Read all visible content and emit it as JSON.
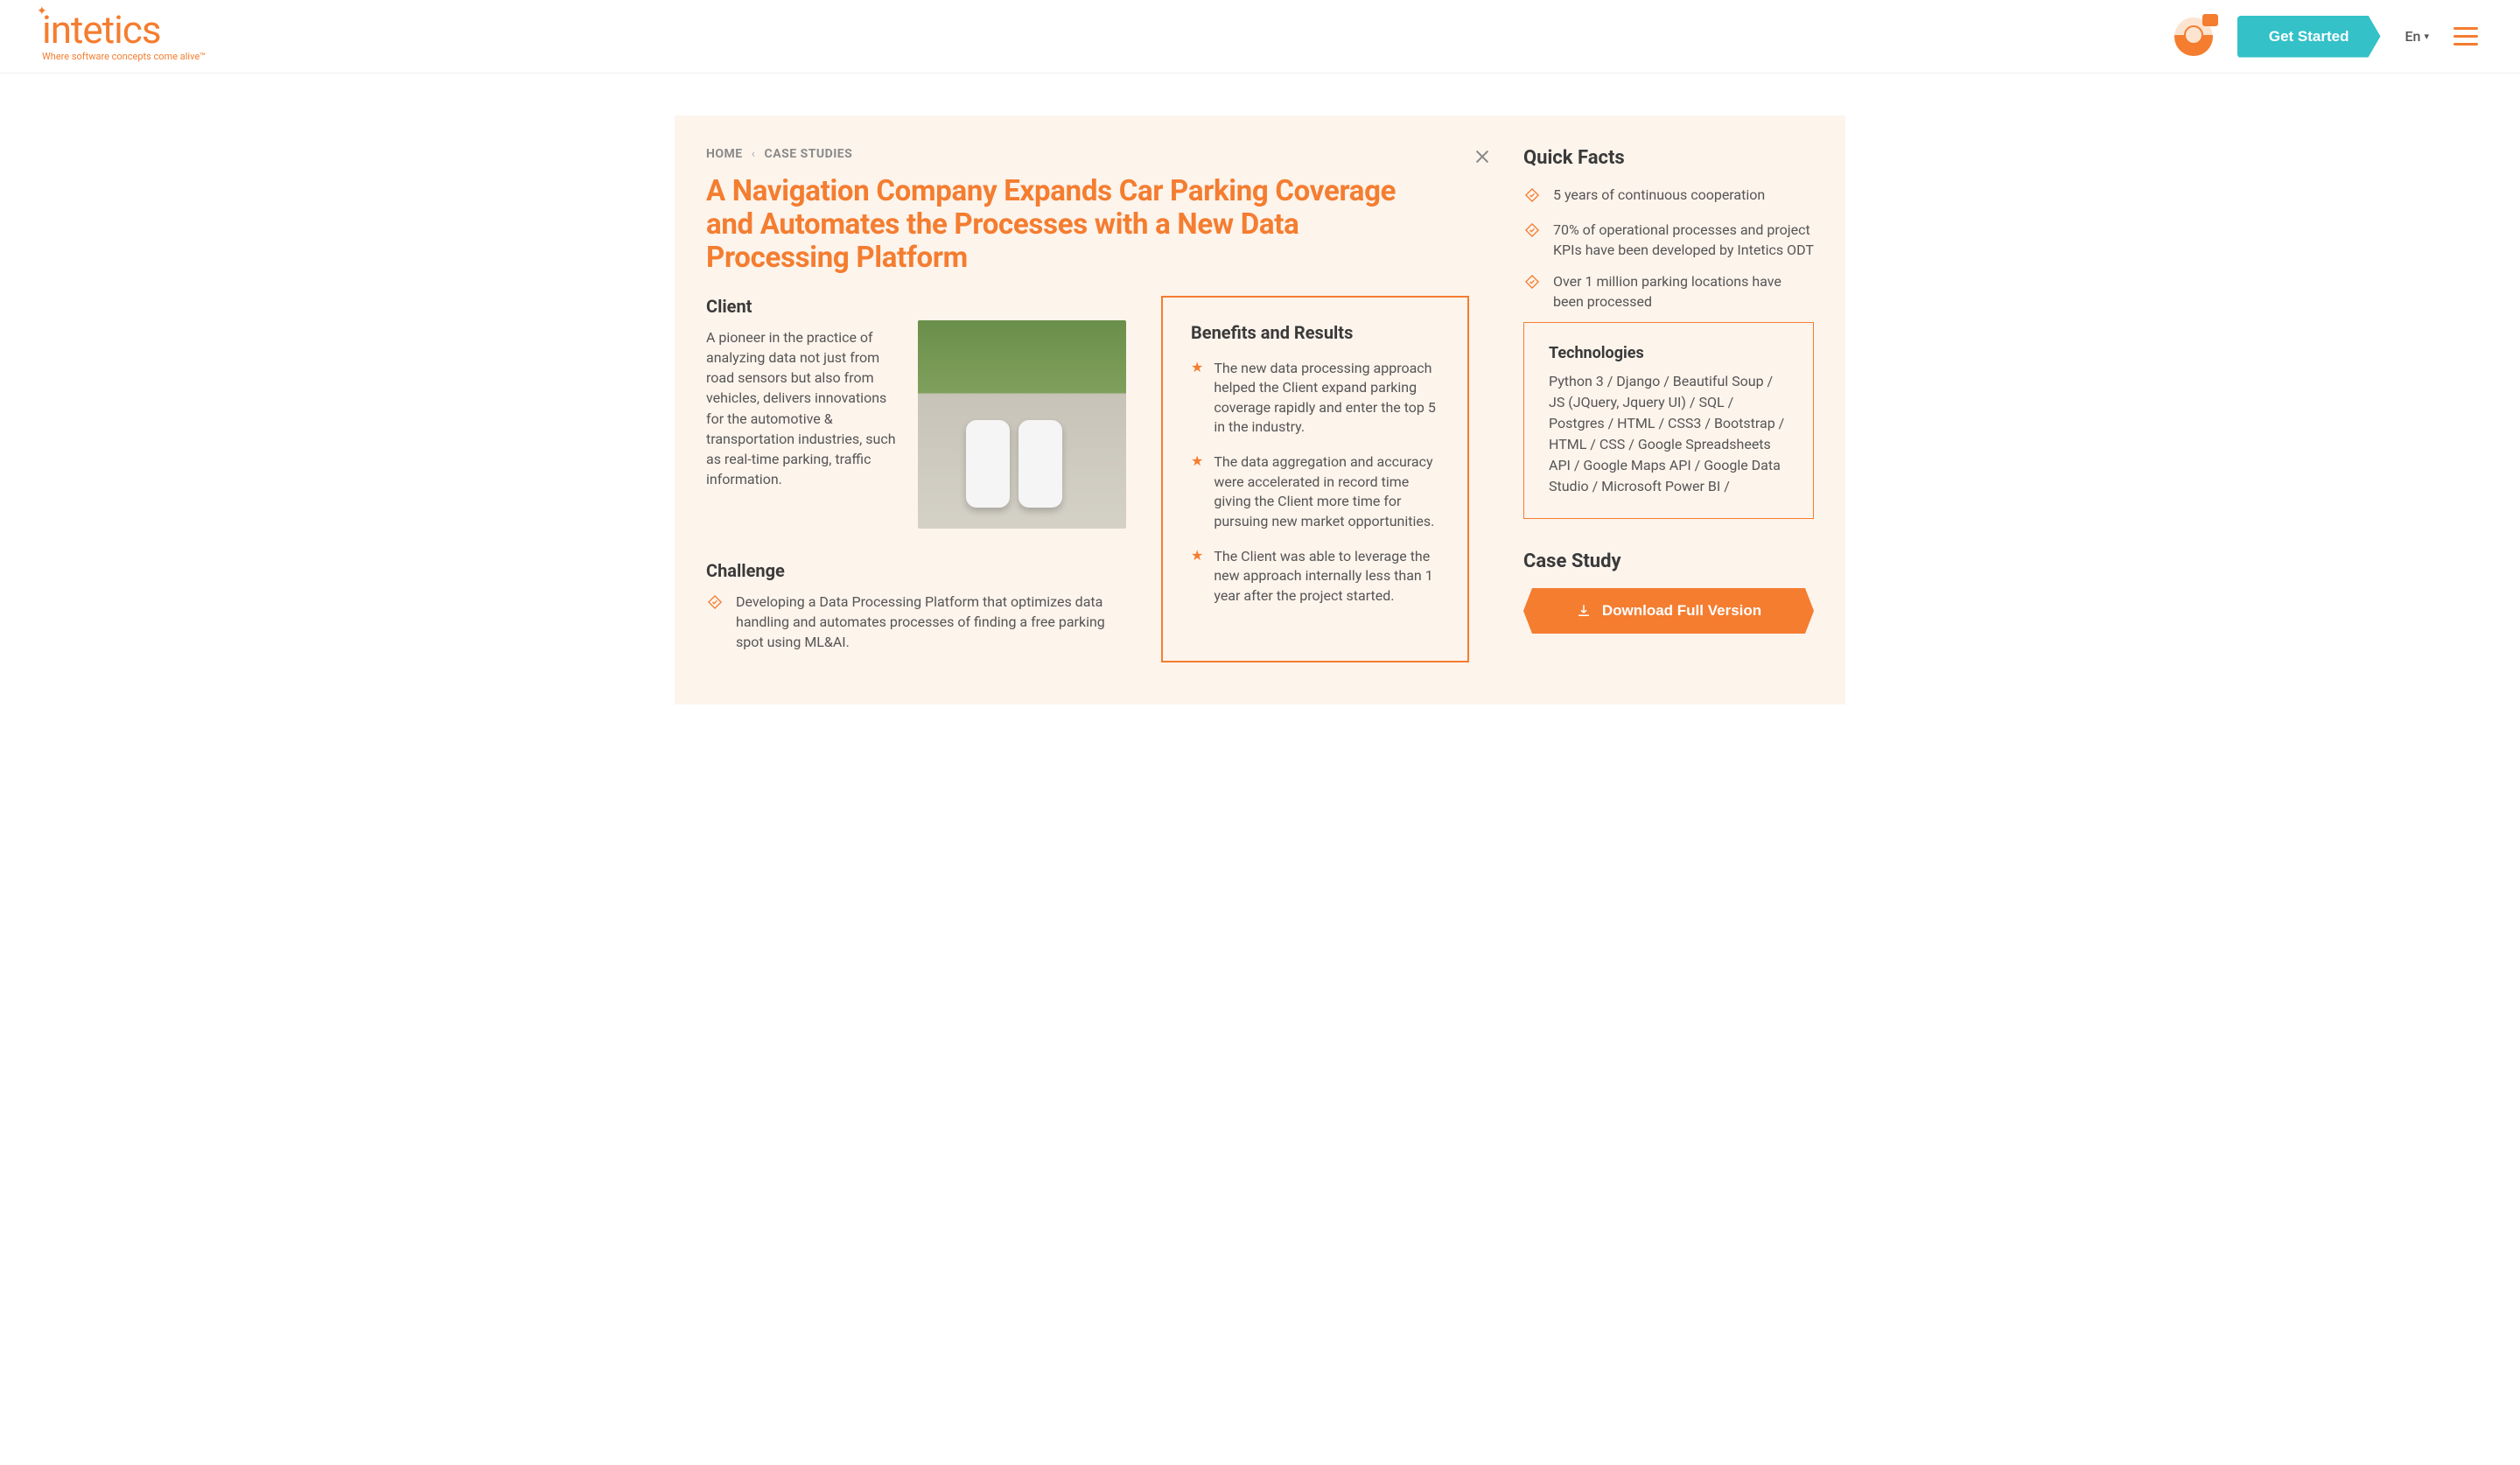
{
  "header": {
    "logo_text": "intetics",
    "logo_tagline": "Where software concepts come alive™",
    "get_started": "Get Started",
    "lang": "En"
  },
  "breadcrumbs": {
    "home": "HOME",
    "section": "CASE STUDIES"
  },
  "title": "A Navigation Company Expands Car Parking Coverage and Automates the Processes with a New Data Processing Platform",
  "client": {
    "heading": "Client",
    "body": "A pioneer in the practice of analyzing data not just from road sensors but also from vehicles, delivers innovations for the automotive & transportation industries, such as real-time parking, traffic information."
  },
  "challenge": {
    "heading": "Challenge",
    "items": [
      "Developing a Data Processing Platform that optimizes data handling and automates processes of finding a free parking spot using ML&AI."
    ]
  },
  "benefits": {
    "heading": "Benefits and Results",
    "items": [
      "The new data processing approach helped the Client expand parking coverage rapidly and enter the top 5 in the industry.",
      "The data aggregation and accuracy were accelerated in record time giving the Client more time for pursuing new market opportunities.",
      "The Client was able to leverage the new approach internally less than 1 year after the project started."
    ]
  },
  "quickfacts": {
    "heading": "Quick Facts",
    "items": [
      "5 years of continuous cooperation",
      "70% of operational processes and project KPIs have been developed by Intetics ODT",
      "Over 1 million parking locations have been processed"
    ]
  },
  "technologies": {
    "heading": "Technologies",
    "body": "Python 3 / Django / Beautiful Soup / JS (JQuery, Jquery UI) / SQL / Postgres / HTML / CSS3 / Bootstrap / HTML / CSS / Google Spreadsheets API / Google Maps API / Google Data Studio / Microsoft Power BI /"
  },
  "casestudy": {
    "heading": "Case Study",
    "button": "Download Full Version"
  }
}
